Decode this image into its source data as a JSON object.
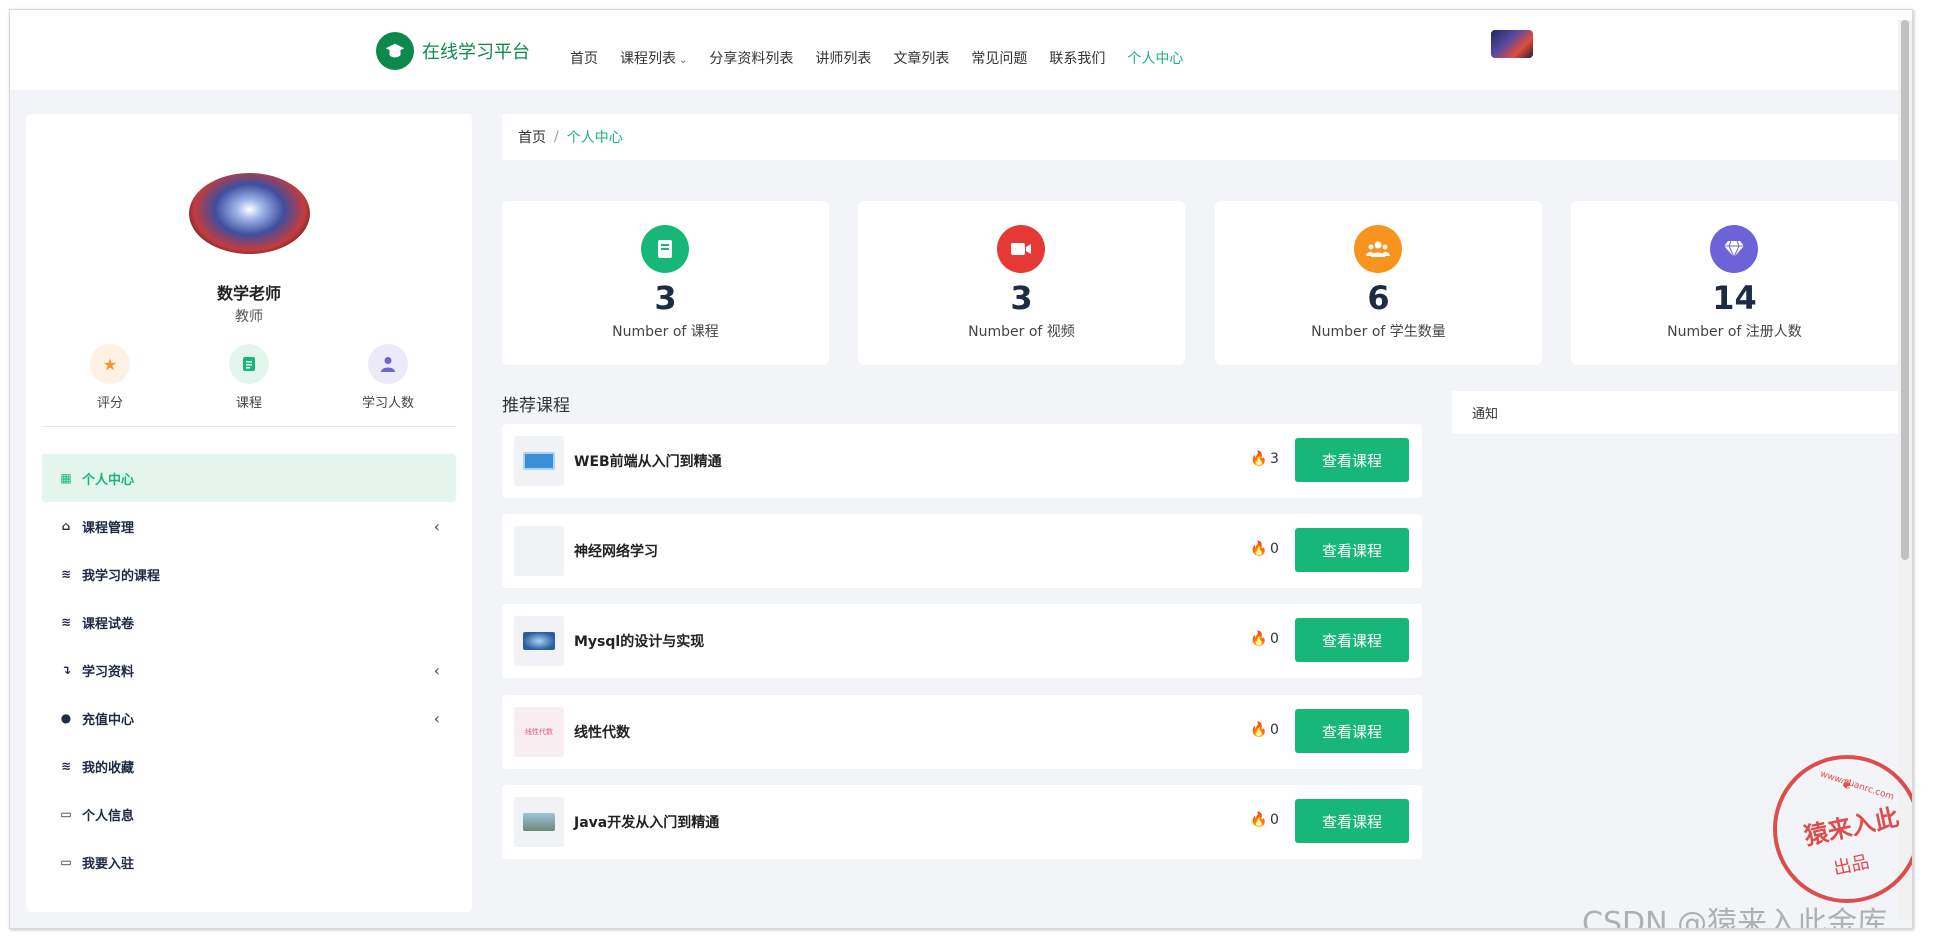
{
  "brand": {
    "logo_icon": "graduation-cap-icon",
    "title": "在线学习平台",
    "color": "#0d8a4b"
  },
  "nav": {
    "items": [
      {
        "label": "首页",
        "dropdown": false,
        "active": false
      },
      {
        "label": "课程列表",
        "dropdown": true,
        "active": false
      },
      {
        "label": "分享资料列表",
        "dropdown": false,
        "active": false
      },
      {
        "label": "讲师列表",
        "dropdown": false,
        "active": false
      },
      {
        "label": "文章列表",
        "dropdown": false,
        "active": false
      },
      {
        "label": "常见问题",
        "dropdown": false,
        "active": false
      },
      {
        "label": "联系我们",
        "dropdown": false,
        "active": false
      },
      {
        "label": "个人中心",
        "dropdown": false,
        "active": true
      }
    ],
    "active_color": "#16b777"
  },
  "profile": {
    "name": "数学老师",
    "role": "教师",
    "quick_stats": [
      {
        "label": "评分",
        "icon": "star-icon",
        "color": "#f7941d",
        "bg": "#fdf1e3"
      },
      {
        "label": "课程",
        "icon": "document-icon",
        "color": "#16b777",
        "bg": "#e4f5ed"
      },
      {
        "label": "学习人数",
        "icon": "user-icon",
        "color": "#6c63d9",
        "bg": "#eceaf9"
      }
    ]
  },
  "sidebar_menu": [
    {
      "label": "个人中心",
      "icon": "grid-icon",
      "active": true,
      "expandable": false
    },
    {
      "label": "课程管理",
      "icon": "basket-icon",
      "active": false,
      "expandable": true
    },
    {
      "label": "我学习的课程",
      "icon": "layers-icon",
      "active": false,
      "expandable": false
    },
    {
      "label": "课程试卷",
      "icon": "layers-icon",
      "active": false,
      "expandable": false
    },
    {
      "label": "学习资料",
      "icon": "arrow-turn-icon",
      "active": false,
      "expandable": true
    },
    {
      "label": "充值中心",
      "icon": "user-icon",
      "active": false,
      "expandable": true
    },
    {
      "label": "我的收藏",
      "icon": "layers-icon",
      "active": false,
      "expandable": false
    },
    {
      "label": "个人信息",
      "icon": "id-card-icon",
      "active": false,
      "expandable": false
    },
    {
      "label": "我要入驻",
      "icon": "id-card-icon",
      "active": false,
      "expandable": false
    }
  ],
  "breadcrumb": {
    "home": "首页",
    "separator": "/",
    "current": "个人中心"
  },
  "stat_cards": [
    {
      "value": "3",
      "label": "Number of 课程",
      "icon": "book-icon",
      "color": "#16b777"
    },
    {
      "value": "3",
      "label": "Number of 视频",
      "icon": "video-icon",
      "color": "#e53935"
    },
    {
      "value": "6",
      "label": "Number of 学生数量",
      "icon": "users-icon",
      "color": "#f7941d"
    },
    {
      "value": "14",
      "label": "Number of 注册人数",
      "icon": "diamond-icon",
      "color": "#6c63d9"
    }
  ],
  "recommended": {
    "title": "推荐课程",
    "button_label": "查看课程",
    "courses": [
      {
        "name": "WEB前端从入门到精通",
        "count": "3",
        "thumb_color": "#3a8fd6"
      },
      {
        "name": "神经网络学习",
        "count": "0",
        "thumb_color": ""
      },
      {
        "name": "Mysql的设计与实现",
        "count": "0",
        "thumb_color": "#2b5d9e"
      },
      {
        "name": "线性代数",
        "count": "0",
        "thumb_color": "#f6c9d4",
        "thumb_text": "线性代数"
      },
      {
        "name": "Java开发从入门到精通",
        "count": "0",
        "thumb_color": "#6b8a7a"
      }
    ]
  },
  "notice": {
    "title": "通知"
  },
  "watermark": {
    "stamp_main": "猿来入此",
    "stamp_sub": "出品",
    "stamp_url": "www.yuanrc.com",
    "csdn_text": "CSDN @猿来入此金库",
    "color": "#d93030"
  }
}
